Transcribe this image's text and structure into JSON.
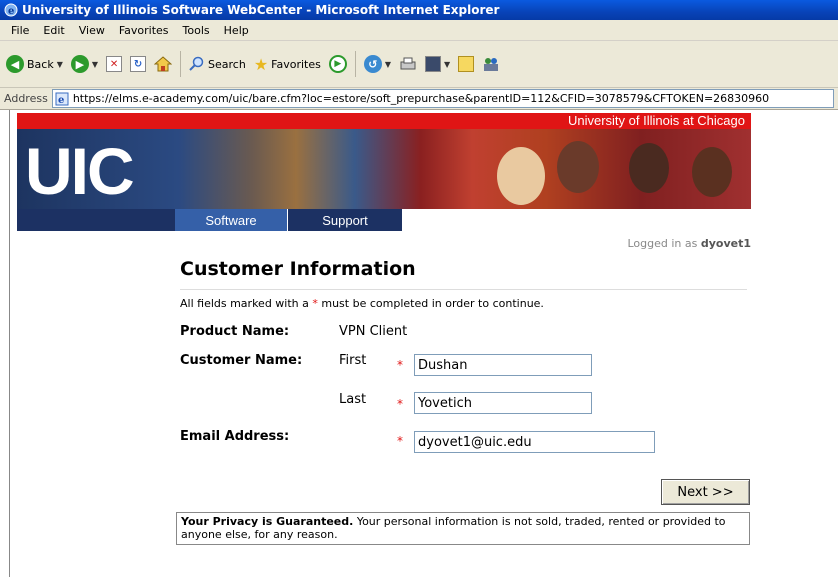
{
  "window": {
    "title": "University of Illinois Software WebCenter - Microsoft Internet Explorer"
  },
  "menu": [
    "File",
    "Edit",
    "View",
    "Favorites",
    "Tools",
    "Help"
  ],
  "toolbar": {
    "back": "Back",
    "search": "Search",
    "favorites": "Favorites"
  },
  "address": {
    "label": "Address",
    "url": "https://elms.e-academy.com/uic/bare.cfm?loc=estore/soft_prepurchase&parentID=112&CFID=3078579&CFTOKEN=26830960"
  },
  "banner": {
    "university": "University of Illinois at Chicago",
    "logo": "UIC"
  },
  "nav": {
    "tabs": [
      "Software",
      "Support"
    ]
  },
  "session": {
    "prefix": "Logged in as",
    "user": "dyovet1"
  },
  "form": {
    "heading": "Customer Information",
    "note_before": "All fields marked with a",
    "note_star": "*",
    "note_after": "must be completed in order to continue.",
    "product_label": "Product Name:",
    "product_value": "VPN Client",
    "customer_label": "Customer Name:",
    "first_label": "First",
    "first_value": "Dushan",
    "last_label": "Last",
    "last_value": "Yovetich",
    "email_label": "Email Address:",
    "email_value": "dyovet1@uic.edu",
    "required_mark": "*",
    "next_label": "Next >>"
  },
  "privacy": {
    "bold": "Your Privacy is Guaranteed.",
    "text": "Your personal information is not sold, traded, rented or provided to anyone else, for any reason."
  },
  "colors": {
    "titlebar": "#0843b8",
    "chrome": "#ece9d8",
    "uic_red": "#e01515",
    "uic_navy": "#1c3163",
    "tab_active": "#3560a8"
  }
}
